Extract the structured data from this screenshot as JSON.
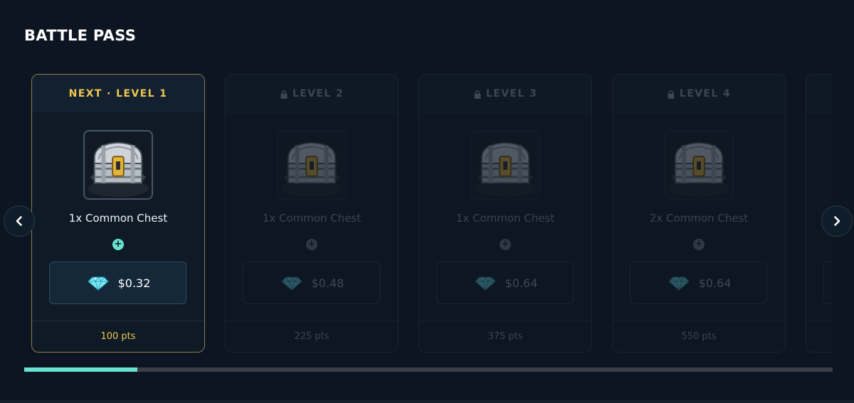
{
  "header": {
    "title": "BATTLE PASS"
  },
  "colors": {
    "accent": "#69e3cf",
    "gold": "#f0c64f",
    "background": "#0c1521"
  },
  "levels": [
    {
      "header": "NEXT · LEVEL 1",
      "locked": false,
      "reward": "1x Common Chest",
      "price": "$0.32",
      "points": "100 pts",
      "icon": "treasure-chest-icon"
    },
    {
      "header": "LEVEL 2",
      "locked": true,
      "reward": "1x Common Chest",
      "price": "$0.48",
      "points": "225 pts",
      "icon": "treasure-chest-icon"
    },
    {
      "header": "LEVEL 3",
      "locked": true,
      "reward": "1x Common Chest",
      "price": "$0.64",
      "points": "375 pts",
      "icon": "treasure-chest-icon"
    },
    {
      "header": "LEVEL 4",
      "locked": true,
      "reward": "2x Common Chest",
      "price": "$0.64",
      "points": "550 pts",
      "icon": "treasure-chest-icon"
    },
    {
      "header": "",
      "locked": true,
      "reward": "",
      "price": "",
      "points": "",
      "icon": "treasure-chest-icon"
    }
  ],
  "navigation": {
    "prev_icon": "chevron-left-icon",
    "next_icon": "chevron-right-icon"
  },
  "progress": {
    "fraction": 0.14
  }
}
